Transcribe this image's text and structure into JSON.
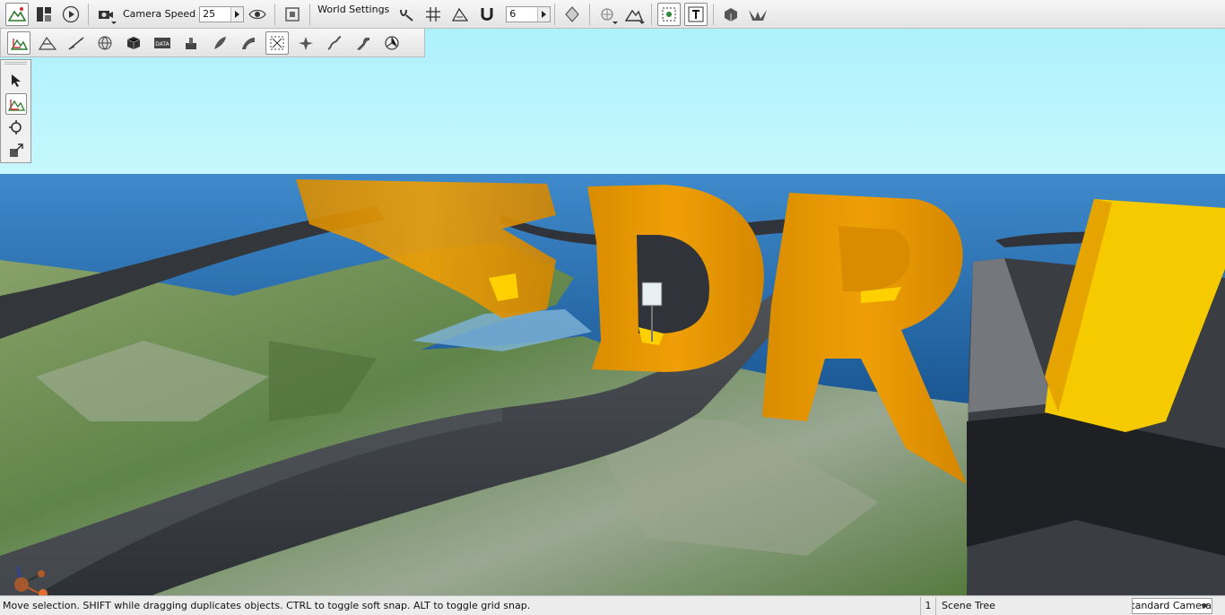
{
  "toolbar": {
    "camera_speed_label": "Camera Speed",
    "camera_speed_value": "25",
    "world_settings_label": "World Settings",
    "snap_value": "6"
  },
  "statusbar": {
    "message": "Move selection.  SHIFT while dragging duplicates objects.  CTRL to toggle soft snap.  ALT to toggle grid snap.",
    "count": "1",
    "scene_tree_label": "Scene Tree",
    "camera_select_value": "Standard Camera"
  },
  "scene": {
    "letters": [
      "D",
      "R"
    ],
    "colors": {
      "sky": "#b7f3fb",
      "sea": "#1f5f9e",
      "letters": "#e89a00",
      "road": "#3a3e44",
      "terrain": "#6f8f55"
    }
  }
}
